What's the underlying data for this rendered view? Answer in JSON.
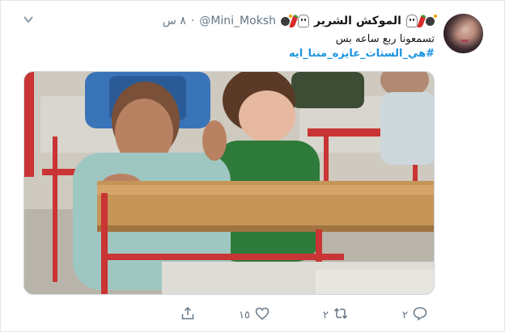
{
  "tweet": {
    "display_name": "الموكش الشرير",
    "handle": "@Mini_Moksh",
    "separator": "·",
    "time": "٨ س",
    "text": "تسمعونا ربع ساعه بس",
    "hashtag": "#هي_الستات_عايزه_مننا_ايه"
  },
  "actions": {
    "reply_count": "٢",
    "retweet_count": "٢",
    "like_count": "١٥",
    "share_count": ""
  },
  "icons": {
    "caret": "chevron-down-icon",
    "reply": "reply-icon",
    "retweet": "retweet-icon",
    "like": "heart-icon",
    "share": "share-icon"
  },
  "colors": {
    "link": "#1b95e0",
    "secondary_text": "#657786",
    "primary_text": "#14171a"
  }
}
